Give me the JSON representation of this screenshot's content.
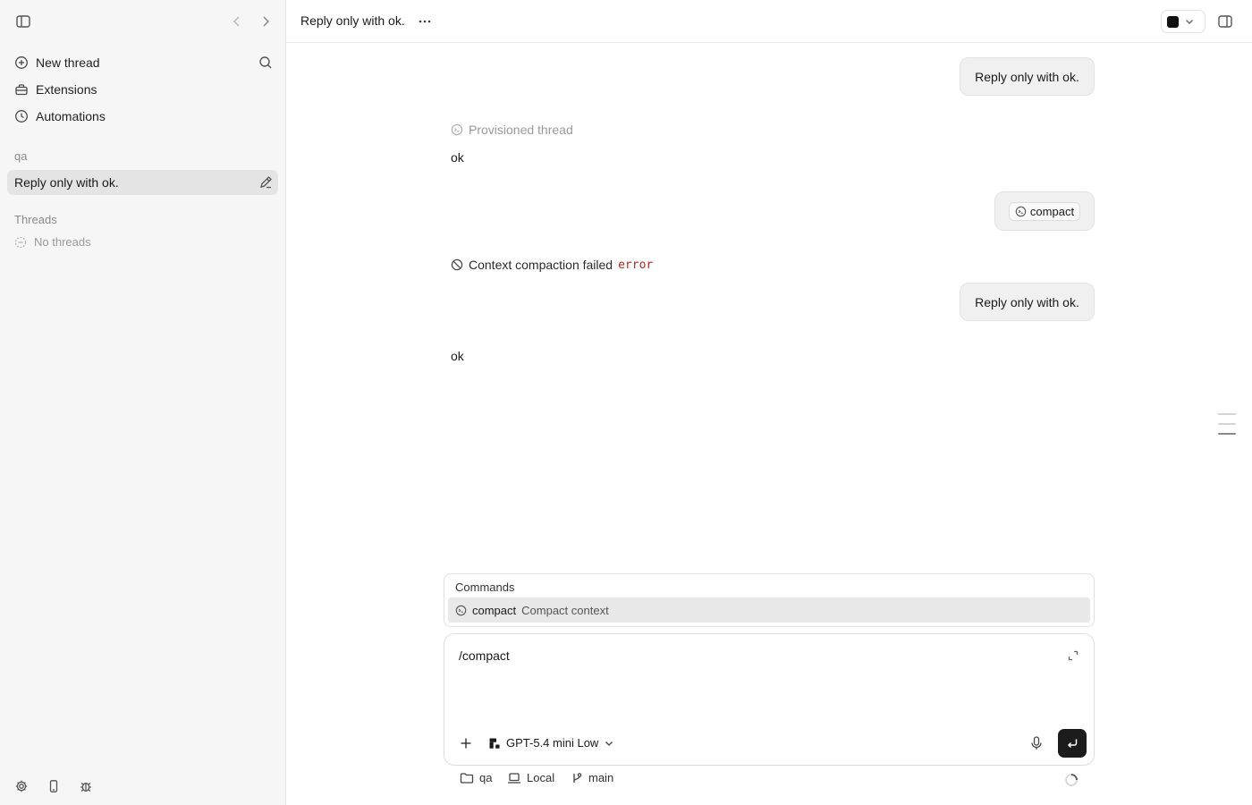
{
  "sidebar": {
    "nav": [
      {
        "label": "New thread",
        "icon": "plus-circle-icon"
      },
      {
        "label": "Extensions",
        "icon": "toolbox-icon"
      },
      {
        "label": "Automations",
        "icon": "clock-icon"
      }
    ],
    "project_label": "qa",
    "active_thread": "Reply only with ok.",
    "threads_label": "Threads",
    "empty_label": "No threads"
  },
  "header": {
    "title": "Reply only with ok."
  },
  "conversation": {
    "user_message_1": "Reply only with ok.",
    "provisioned_label": "Provisioned thread",
    "assistant_reply_1": "ok",
    "command_chip": "compact",
    "compaction_failed": "Context compaction failed",
    "error_code": "error",
    "user_message_2": "Reply only with ok.",
    "assistant_reply_2": "ok"
  },
  "commands_popup": {
    "title": "Commands",
    "items": [
      {
        "name": "compact",
        "description": "Compact context"
      }
    ]
  },
  "composer": {
    "input_value": "/compact",
    "model_label": "GPT-5.4 mini Low"
  },
  "footer": {
    "folder": "qa",
    "environment": "Local",
    "branch": "main"
  },
  "colors": {
    "sidebar_bg": "#f6f6f6",
    "active_item_bg": "#e4e4e4",
    "bubble_bg": "#f0f0f0",
    "error_red": "#b3261e",
    "send_button": "#1c1c1c"
  }
}
